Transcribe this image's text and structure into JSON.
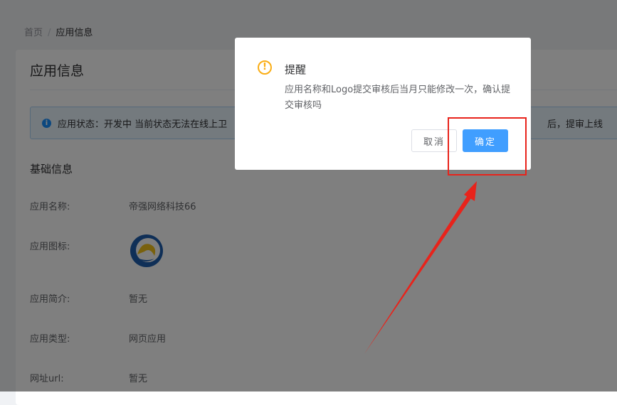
{
  "breadcrumb": {
    "home": "首页",
    "separator": "/",
    "current": "应用信息"
  },
  "card": {
    "title": "应用信息"
  },
  "alert": {
    "icon": "info-icon",
    "text_left": "应用状态：开发中  当前状态无法在线上卫",
    "text_right": "后，提审上线"
  },
  "basic_info": {
    "title": "基础信息",
    "rows": [
      {
        "label": "应用名称:",
        "value": "帝强网络科技66"
      },
      {
        "label": "应用图标:",
        "value": ""
      },
      {
        "label": "应用简介:",
        "value": "暂无"
      },
      {
        "label": "应用类型:",
        "value": "网页应用"
      },
      {
        "label": "网址url:",
        "value": "暂无"
      }
    ]
  },
  "dialog": {
    "icon": "warning-icon",
    "title": "提醒",
    "message": "应用名称和Logo提交审核后当月只能修改一次，确认提交审核吗",
    "cancel_label": "取消",
    "confirm_label": "确定"
  },
  "colors": {
    "primary": "#409eff",
    "warning": "#faad14",
    "annotation": "#e8231b",
    "alert_bg": "#e8f4fd"
  }
}
